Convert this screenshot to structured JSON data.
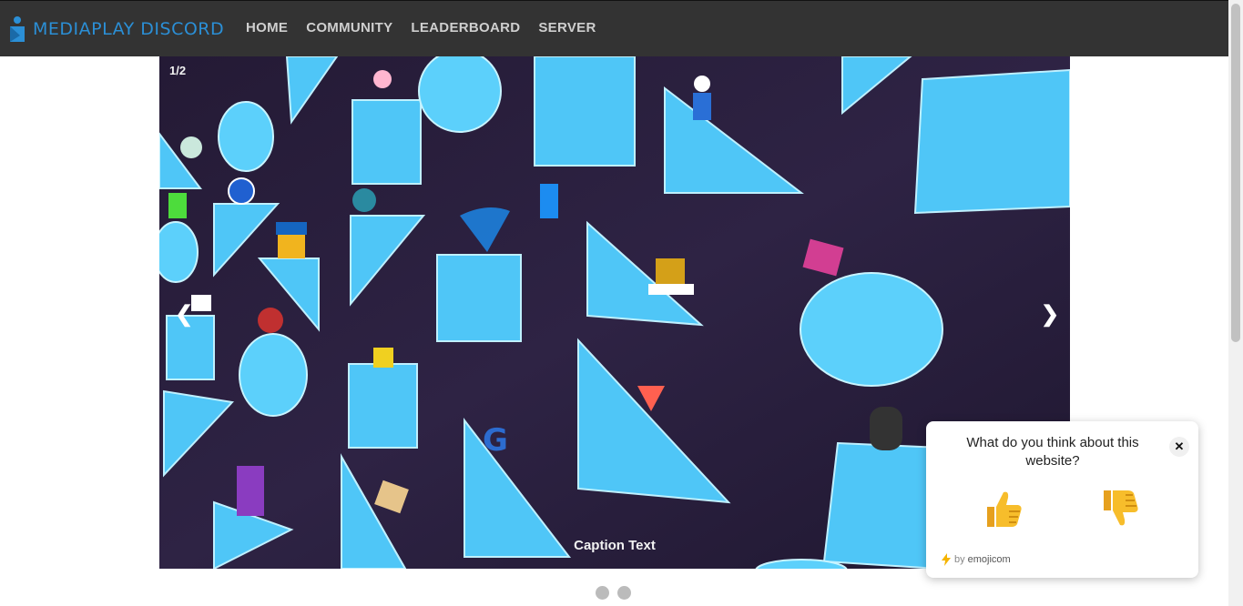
{
  "navbar": {
    "brand": "MEDIAPLAY DISCORD",
    "links": [
      "HOME",
      "COMMUNITY",
      "LEADERBOARD",
      "SERVER"
    ]
  },
  "slideshow": {
    "counter": "1/2",
    "caption": "Caption Text",
    "prev_arrow": "❮",
    "next_arrow": "❯",
    "dots": 2,
    "current_slide": 1
  },
  "feedback": {
    "question": "What do you think about this website?",
    "close": "✕",
    "credit_by": "by",
    "credit_brand": "emojicom"
  },
  "colors": {
    "navbar_bg": "#333333",
    "brand": "#2b8fd6",
    "slide_bg": "#2a1f3d",
    "shape": "#4cc4f5"
  }
}
